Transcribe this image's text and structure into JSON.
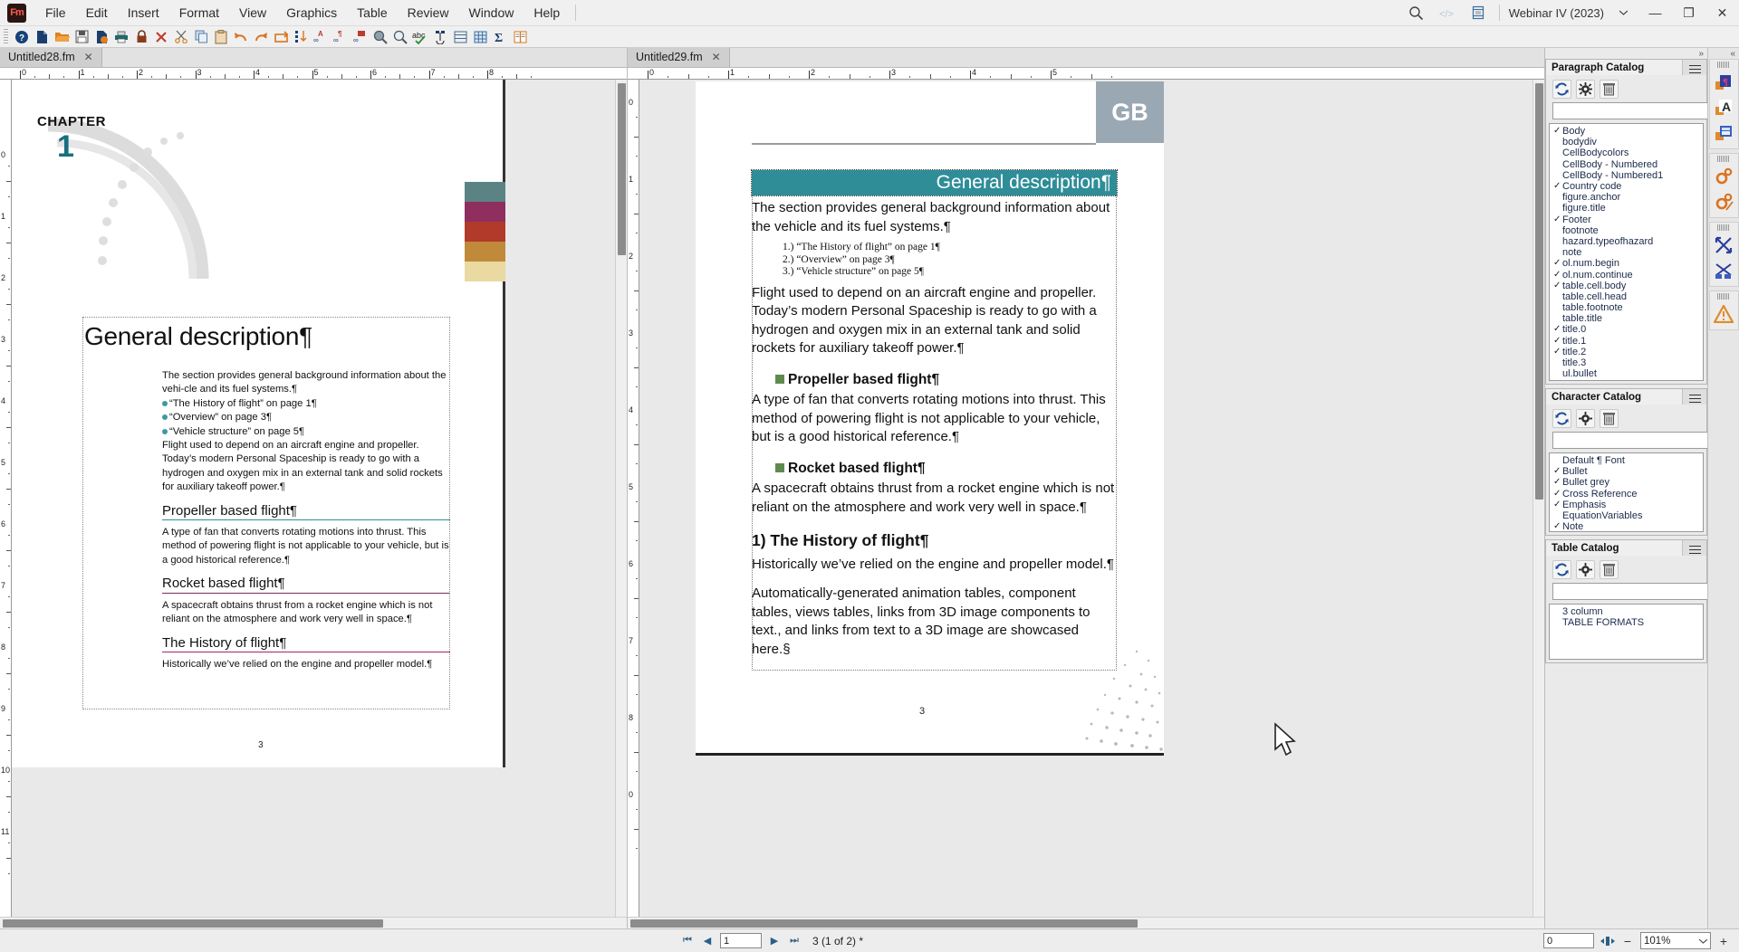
{
  "app": {
    "logo": "Fm",
    "workspace": "Webinar IV (2023)",
    "menus": [
      "File",
      "Edit",
      "Insert",
      "Format",
      "View",
      "Graphics",
      "Table",
      "Review",
      "Window",
      "Help"
    ],
    "window_controls": {
      "minimize": "—",
      "restore": "❐",
      "close": "✕"
    },
    "top_icons": [
      "search-icon",
      "code-view-icon",
      "pod-icon"
    ]
  },
  "toolbar": {
    "items": [
      "help-icon",
      "new-doc-icon",
      "open-folder-icon",
      "save-icon",
      "save-as-icon",
      "print-icon",
      "lock-icon",
      "close-x-icon",
      "cut-scissors-icon",
      "copy-icon",
      "paste-icon",
      "undo-icon",
      "redo-icon",
      "repeat-icon",
      "sort-icon",
      "find-font-icon",
      "find-paragraph-icon",
      "find-table-icon",
      "zoom-in-icon",
      "zoom-out-icon",
      "spellcheck-icon",
      "anchor-icon",
      "table-insert-icon",
      "table-grid-icon",
      "equation-sigma-icon",
      "columns-icon"
    ]
  },
  "panes": {
    "left": {
      "tab_label": "Untitled28.fm",
      "tab_close": "✕",
      "ruler_numbers": [
        "0",
        "1",
        "2",
        "3",
        "4",
        "5",
        "6",
        "7",
        "8"
      ],
      "vruler_numbers": [
        "0",
        "1",
        "2",
        "3",
        "4",
        "5",
        "6",
        "7",
        "8",
        "9",
        "10",
        "11"
      ],
      "page": {
        "chapter_word": "CHAPTER",
        "chapter_number": "1",
        "heading": "General description¶",
        "intro": "The section provides general background information about the vehi-cle and its fuel systems.¶",
        "xrefs": [
          "“The History of flight” on page 1¶",
          "“Overview” on page 3¶",
          "“Vehicle structure” on page 5¶"
        ],
        "para1": "Flight used to depend on an aircraft engine and propeller. Today’s modern Personal Spaceship is ready to go with a hydrogen and oxygen mix in an external tank and solid rockets for auxiliary takeoff power.¶",
        "h_propeller": "Propeller based flight¶",
        "para_propeller": "A type of fan that converts rotating motions into thrust. This method of powering flight is not applicable to your vehicle, but is a good historical reference.¶",
        "h_rocket": "Rocket based flight¶",
        "para_rocket": "A spacecraft obtains thrust from a rocket engine which is not reliant on the atmosphere and work very well in space.¶",
        "h_history": "The History of flight¶",
        "para_history": "Historically we’ve relied on the engine and propeller model.¶",
        "page_number": "3",
        "swatch_colors": [
          "#5b8384",
          "#8e2f5f",
          "#b23a2a",
          "#c08a3a",
          "#ead9a0"
        ]
      }
    },
    "right": {
      "tab_label": "Untitled29.fm",
      "tab_close": "✕",
      "ruler_numbers": [
        "0",
        "1",
        "2",
        "3",
        "4",
        "5"
      ],
      "vruler_numbers": [
        "0",
        "1",
        "2",
        "3",
        "4",
        "5",
        "6",
        "7",
        "8",
        "0"
      ],
      "page": {
        "corner_badge": "GB",
        "title": "General description¶",
        "intro": "The section provides general background information about the vehicle and its fuel systems.¶",
        "numbered_xrefs": [
          "1.)  “The History of flight” on page 1¶",
          "2.)  “Overview” on page 3¶",
          "3.)  “Vehicle structure” on page 5¶"
        ],
        "para1": "Flight used to depend on an aircraft engine and propeller. Today’s modern Personal Spaceship is ready to go with a hydrogen and oxygen mix in an external tank and solid rockets for auxiliary takeoff power.¶",
        "h_propeller": "Propeller based flight¶",
        "para_propeller": "A type of fan that converts rotating motions into thrust. This method of powering flight is not applicable to your vehicle, but is a good historical reference.¶",
        "h_rocket": "Rocket based flight¶",
        "para_rocket": "A spacecraft obtains thrust from a rocket engine which is not reliant on the atmosphere and work very well in space.¶",
        "h_history": "1)  The History of flight¶",
        "para_history": "Historically we’ve relied on the engine and propeller model.¶",
        "para_auto": "Automatically-generated animation tables, component tables, views tables, links from 3D image components to text., and links from text to a 3D image are showcased here.§",
        "page_number": "3",
        "title_bg": "#2f8d98",
        "badge_bg": "#9aa8b4"
      }
    }
  },
  "dock": {
    "expand_all": "»",
    "collapse_all": "«",
    "paragraph_catalog": {
      "title": "Paragraph Catalog",
      "tools": [
        "refresh-icon",
        "gear-icon",
        "delete-icon"
      ],
      "search_value": "",
      "clear_label": "✕",
      "items": [
        {
          "name": "Body",
          "checked": true
        },
        {
          "name": "bodydiv",
          "checked": false
        },
        {
          "name": "CellBodycolors",
          "checked": false
        },
        {
          "name": "CellBody - Numbered",
          "checked": false
        },
        {
          "name": "CellBody - Numbered1",
          "checked": false
        },
        {
          "name": "Country code",
          "checked": true
        },
        {
          "name": "figure.anchor",
          "checked": false
        },
        {
          "name": "figure.title",
          "checked": false
        },
        {
          "name": "Footer",
          "checked": true
        },
        {
          "name": "footnote",
          "checked": false
        },
        {
          "name": "hazard.typeofhazard",
          "checked": false
        },
        {
          "name": "note",
          "checked": false
        },
        {
          "name": "ol.num.begin",
          "checked": true
        },
        {
          "name": "ol.num.continue",
          "checked": true
        },
        {
          "name": "table.cell.body",
          "checked": true
        },
        {
          "name": "table.cell.head",
          "checked": false
        },
        {
          "name": "table.footnote",
          "checked": false
        },
        {
          "name": "table.title",
          "checked": false
        },
        {
          "name": "title.0",
          "checked": true
        },
        {
          "name": "title.1",
          "checked": true
        },
        {
          "name": "title.2",
          "checked": true
        },
        {
          "name": "title.3",
          "checked": false
        },
        {
          "name": "ul.bullet",
          "checked": false
        }
      ]
    },
    "character_catalog": {
      "title": "Character Catalog",
      "tools": [
        "refresh-icon",
        "gear-icon",
        "delete-icon"
      ],
      "search_value": "",
      "clear_label": "✕",
      "items": [
        {
          "name": "Default ¶ Font",
          "checked": false
        },
        {
          "name": "Bullet",
          "checked": true
        },
        {
          "name": "Bullet grey",
          "checked": true
        },
        {
          "name": "Cross Reference",
          "checked": true
        },
        {
          "name": "Emphasis",
          "checked": true
        },
        {
          "name": "EquationVariables",
          "checked": false
        },
        {
          "name": "Note",
          "checked": true
        }
      ]
    },
    "table_catalog": {
      "title": "Table Catalog",
      "tools": [
        "refresh-icon",
        "gear-icon",
        "delete-icon"
      ],
      "search_value": "",
      "clear_label": "✕",
      "items": [
        {
          "name": "3 column",
          "checked": false
        },
        {
          "name": "TABLE FORMATS",
          "checked": false
        }
      ]
    },
    "rail_icons": [
      "paragraph-designer-icon",
      "character-designer-icon",
      "table-designer-icon",
      "settings-gear-icon",
      "settings-edit-icon",
      "expand-arrows-icon",
      "structure-icon",
      "warning-icon"
    ]
  },
  "status": {
    "first_page": "⏮",
    "prev_page": "◀",
    "page_value": "1",
    "next_page": "▶",
    "last_page": "⏭",
    "page_info": "3 (1 of 2) *",
    "offset_value": "0",
    "fit_icon": "fit-page-icon",
    "zoom_out": "−",
    "zoom_value": "101%",
    "zoom_in": "+"
  }
}
